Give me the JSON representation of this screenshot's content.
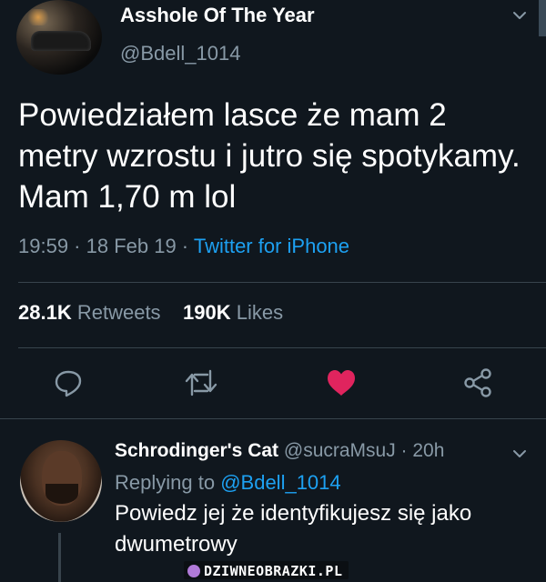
{
  "tweet": {
    "display_name": "Asshole Of The Year",
    "handle": "@Bdell_1014",
    "text": "Powiedziałem lasce że mam 2 metry wzrostu i jutro się spotykamy. Mam 1,70 m lol",
    "time_date": "19:59 · 18 Feb 19 · ",
    "source": "Twitter for iPhone",
    "retweets_count": "28.1K",
    "retweets_label": "Retweets",
    "likes_count": "190K",
    "likes_label": "Likes",
    "actions": [
      "reply-icon",
      "retweet-icon",
      "heart-icon",
      "share-icon"
    ],
    "liked": true
  },
  "reply": {
    "display_name": "Schrodinger's Cat",
    "handle_time": "@sucraMsuJ · 20h",
    "replying_prefix": "Replying to",
    "replying_handle": "@Bdell_1014",
    "text": "Powiedz jej że identyfikujesz się jako dwumetrowy"
  },
  "watermark": "DZIWNEOBRAZKI.PL",
  "colors": {
    "background": "#10171e",
    "secondary_text": "#8899a6",
    "link": "#1da1f2",
    "like": "#e0245e",
    "divider": "#38444d"
  }
}
